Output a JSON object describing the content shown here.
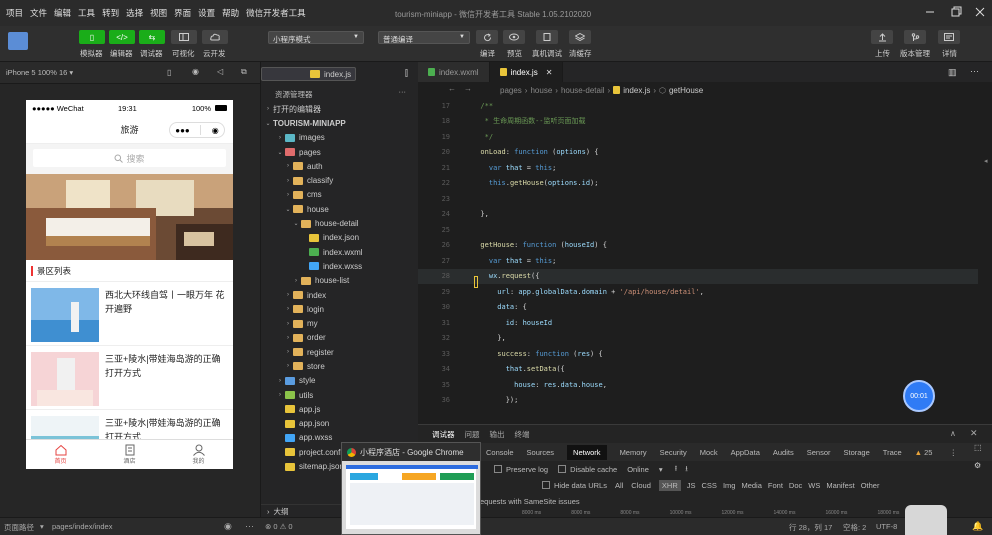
{
  "menu": {
    "items": [
      "项目",
      "文件",
      "编辑",
      "工具",
      "转到",
      "选择",
      "视图",
      "界面",
      "设置",
      "帮助",
      "微信开发者工具"
    ],
    "window_title": "tourism-miniapp - 微信开发者工具 Stable 1.05.2102020"
  },
  "toolbar": {
    "simulator": "模拟器",
    "editor": "编辑器",
    "debugger": "调试器",
    "visual": "可视化",
    "cloud": "云开发",
    "mode_select": "小程序模式",
    "compile_select": "普通编译",
    "compile": "编译",
    "preview": "预览",
    "real_debug": "真机调试",
    "clear_cache": "清缓存",
    "upload": "上传",
    "version": "版本管理",
    "details": "详情",
    "compile_icon": "</>",
    "sim_icon": "▯",
    "debug_icon": "⇆"
  },
  "simulator": {
    "device": "iPhone 5 100% 16 ▾",
    "status_carrier": "●●●●● WeChat",
    "status_time": "19:31",
    "status_battery": "100%",
    "nav_title": "旅游",
    "search_placeholder": "搜索",
    "section_title": "景区列表",
    "list": [
      {
        "title": "西北大环线自驾丨一眼万年 花开遍野"
      },
      {
        "title": "三亚+陵水|带娃海岛游的正确打开方式"
      },
      {
        "title": "三亚+陵水|带娃海岛游的正确打开方式"
      }
    ],
    "tabs": {
      "home": "首页",
      "hotel": "酒店",
      "mine": "我的"
    }
  },
  "explorer": {
    "header": "资源管理器",
    "open_editors": "打开的编辑器",
    "project": "TOURISM-MINIAPP",
    "tree": [
      {
        "label": "images",
        "arrow": "›",
        "depth": 1,
        "kind": "folder-img"
      },
      {
        "label": "pages",
        "arrow": "⌄",
        "depth": 1,
        "kind": "folder-red"
      },
      {
        "label": "auth",
        "arrow": "›",
        "depth": 2,
        "kind": "folder"
      },
      {
        "label": "classify",
        "arrow": "›",
        "depth": 2,
        "kind": "folder"
      },
      {
        "label": "cms",
        "arrow": "›",
        "depth": 2,
        "kind": "folder"
      },
      {
        "label": "house",
        "arrow": "⌄",
        "depth": 2,
        "kind": "folder"
      },
      {
        "label": "house-detail",
        "arrow": "⌄",
        "depth": 3,
        "kind": "folder"
      },
      {
        "label": "index.js",
        "arrow": "",
        "depth": 4,
        "kind": "js",
        "selected": true
      },
      {
        "label": "index.json",
        "arrow": "",
        "depth": 4,
        "kind": "json"
      },
      {
        "label": "index.wxml",
        "arrow": "",
        "depth": 4,
        "kind": "wxml"
      },
      {
        "label": "index.wxss",
        "arrow": "",
        "depth": 4,
        "kind": "wxss"
      },
      {
        "label": "house-list",
        "arrow": "›",
        "depth": 3,
        "kind": "folder"
      },
      {
        "label": "index",
        "arrow": "›",
        "depth": 2,
        "kind": "folder"
      },
      {
        "label": "login",
        "arrow": "›",
        "depth": 2,
        "kind": "folder"
      },
      {
        "label": "my",
        "arrow": "›",
        "depth": 2,
        "kind": "folder"
      },
      {
        "label": "order",
        "arrow": "›",
        "depth": 2,
        "kind": "folder"
      },
      {
        "label": "register",
        "arrow": "›",
        "depth": 2,
        "kind": "folder"
      },
      {
        "label": "store",
        "arrow": "›",
        "depth": 2,
        "kind": "folder"
      },
      {
        "label": "style",
        "arrow": "›",
        "depth": 1,
        "kind": "folder-blue"
      },
      {
        "label": "utils",
        "arrow": "›",
        "depth": 1,
        "kind": "folder-green"
      },
      {
        "label": "app.js",
        "arrow": "",
        "depth": 1,
        "kind": "js"
      },
      {
        "label": "app.json",
        "arrow": "",
        "depth": 1,
        "kind": "json"
      },
      {
        "label": "app.wxss",
        "arrow": "",
        "depth": 1,
        "kind": "wxss"
      },
      {
        "label": "project.config.json",
        "arrow": "",
        "depth": 1,
        "kind": "json"
      },
      {
        "label": "sitemap.json",
        "arrow": "",
        "depth": 1,
        "kind": "json"
      }
    ],
    "outline": "大纲",
    "problems": "⊗ 0 ⚠ 0"
  },
  "editor": {
    "tabs": [
      {
        "label": "index.wxml",
        "active": false
      },
      {
        "label": "index.js",
        "active": true
      }
    ],
    "breadcrumb": [
      "pages",
      "house",
      "house-detail",
      "index.js",
      "getHouse"
    ],
    "lines": [
      {
        "n": "17",
        "tokens": [
          [
            "cmt",
            "  /**"
          ]
        ]
      },
      {
        "n": "18",
        "tokens": [
          [
            "cmt",
            "   * 生命周期函数--监听页面加载"
          ]
        ]
      },
      {
        "n": "19",
        "tokens": [
          [
            "cmt",
            "   */"
          ]
        ]
      },
      {
        "n": "20",
        "tokens": [
          [
            "fn",
            "  onLoad"
          ],
          [
            "txt2",
            ": "
          ],
          [
            "kw",
            "function"
          ],
          [
            "txt2",
            " ("
          ],
          [
            "prop",
            "options"
          ],
          [
            "txt2",
            ") {"
          ]
        ]
      },
      {
        "n": "21",
        "tokens": [
          [
            "kw",
            "    var"
          ],
          [
            "txt2",
            " "
          ],
          [
            "prop",
            "that"
          ],
          [
            "txt2",
            " = "
          ],
          [
            "kw",
            "this"
          ],
          [
            "txt2",
            ";"
          ]
        ]
      },
      {
        "n": "22",
        "tokens": [
          [
            "kw",
            "    this"
          ],
          [
            "txt2",
            "."
          ],
          [
            "fn",
            "getHouse"
          ],
          [
            "txt2",
            "("
          ],
          [
            "prop",
            "options"
          ],
          [
            "txt2",
            "."
          ],
          [
            "prop",
            "id"
          ],
          [
            "txt2",
            ");"
          ]
        ]
      },
      {
        "n": "23",
        "tokens": [
          [
            "txt2",
            ""
          ]
        ]
      },
      {
        "n": "24",
        "tokens": [
          [
            "txt2",
            "  },"
          ]
        ]
      },
      {
        "n": "25",
        "tokens": [
          [
            "txt2",
            ""
          ]
        ]
      },
      {
        "n": "26",
        "tokens": [
          [
            "fn",
            "  getHouse"
          ],
          [
            "txt2",
            ": "
          ],
          [
            "kw",
            "function"
          ],
          [
            "txt2",
            " ("
          ],
          [
            "prop",
            "houseId"
          ],
          [
            "txt2",
            ") {"
          ]
        ]
      },
      {
        "n": "27",
        "tokens": [
          [
            "kw",
            "    var"
          ],
          [
            "txt2",
            " "
          ],
          [
            "prop",
            "that"
          ],
          [
            "txt2",
            " = "
          ],
          [
            "kw",
            "this"
          ],
          [
            "txt2",
            ";"
          ]
        ]
      },
      {
        "n": "28",
        "tokens": [
          [
            "prop",
            "    wx"
          ],
          [
            "txt2",
            "."
          ],
          [
            "fn",
            "request"
          ],
          [
            "txt2",
            "({"
          ]
        ]
      },
      {
        "n": "29",
        "tokens": [
          [
            "prop",
            "      url"
          ],
          [
            "txt2",
            ": "
          ],
          [
            "prop",
            "app"
          ],
          [
            "txt2",
            "."
          ],
          [
            "prop",
            "globalData"
          ],
          [
            "txt2",
            "."
          ],
          [
            "prop",
            "domain"
          ],
          [
            "txt2",
            " + "
          ],
          [
            "str",
            "'/api/house/detail'"
          ],
          [
            "txt2",
            ","
          ]
        ]
      },
      {
        "n": "30",
        "tokens": [
          [
            "prop",
            "      data"
          ],
          [
            "txt2",
            ": {"
          ]
        ]
      },
      {
        "n": "31",
        "tokens": [
          [
            "prop",
            "        id"
          ],
          [
            "txt2",
            ": "
          ],
          [
            "prop",
            "houseId"
          ]
        ]
      },
      {
        "n": "32",
        "tokens": [
          [
            "txt2",
            "      },"
          ]
        ]
      },
      {
        "n": "33",
        "tokens": [
          [
            "fn",
            "      success"
          ],
          [
            "txt2",
            ": "
          ],
          [
            "kw",
            "function"
          ],
          [
            "txt2",
            " ("
          ],
          [
            "prop",
            "res"
          ],
          [
            "txt2",
            ") {"
          ]
        ]
      },
      {
        "n": "34",
        "tokens": [
          [
            "prop",
            "        that"
          ],
          [
            "txt2",
            "."
          ],
          [
            "fn",
            "setData"
          ],
          [
            "txt2",
            "({"
          ]
        ]
      },
      {
        "n": "35",
        "tokens": [
          [
            "prop",
            "          house"
          ],
          [
            "txt2",
            ": "
          ],
          [
            "prop",
            "res"
          ],
          [
            "txt2",
            "."
          ],
          [
            "prop",
            "data"
          ],
          [
            "txt2",
            "."
          ],
          [
            "prop",
            "house"
          ],
          [
            "txt2",
            ","
          ]
        ]
      },
      {
        "n": "36",
        "tokens": [
          [
            "txt2",
            "        });"
          ]
        ]
      }
    ]
  },
  "devtools": {
    "top_tabs": [
      "调试器",
      "问题",
      "输出",
      "终端"
    ],
    "tabs": [
      "Console",
      "Sources",
      "Network",
      "Memory",
      "Security",
      "Mock",
      "AppData",
      "Audits",
      "Sensor",
      "Storage",
      "Trace"
    ],
    "active_tab": "Network",
    "warn_count": "25",
    "preserve_log": "Preserve log",
    "disable_cache": "Disable cache",
    "online": "Online",
    "filters": [
      "Hide data URLs",
      "All",
      "Cloud",
      "XHR",
      "JS",
      "CSS",
      "Img",
      "Media",
      "Font",
      "Doc",
      "WS",
      "Manifest",
      "Other"
    ],
    "samesite": "equests with SameSite issues",
    "timeline": [
      "8000 ms",
      "8000 ms",
      "8000 ms",
      "10000 ms",
      "12000 ms",
      "14000 ms",
      "16000 ms",
      "18000 ms"
    ]
  },
  "statusbar": {
    "left_label": "页面路径",
    "path": "pages/index/index",
    "cursor": "行 28，列 17",
    "spaces": "空格: 2",
    "encoding": "UTF-8"
  },
  "popup": {
    "title": "小程序酒店 - Google Chrome"
  },
  "timer": "00:01",
  "colors": {
    "accent_green": "#1aad19",
    "active_red": "#e64340",
    "timer_blue": "#2f7bf5"
  }
}
